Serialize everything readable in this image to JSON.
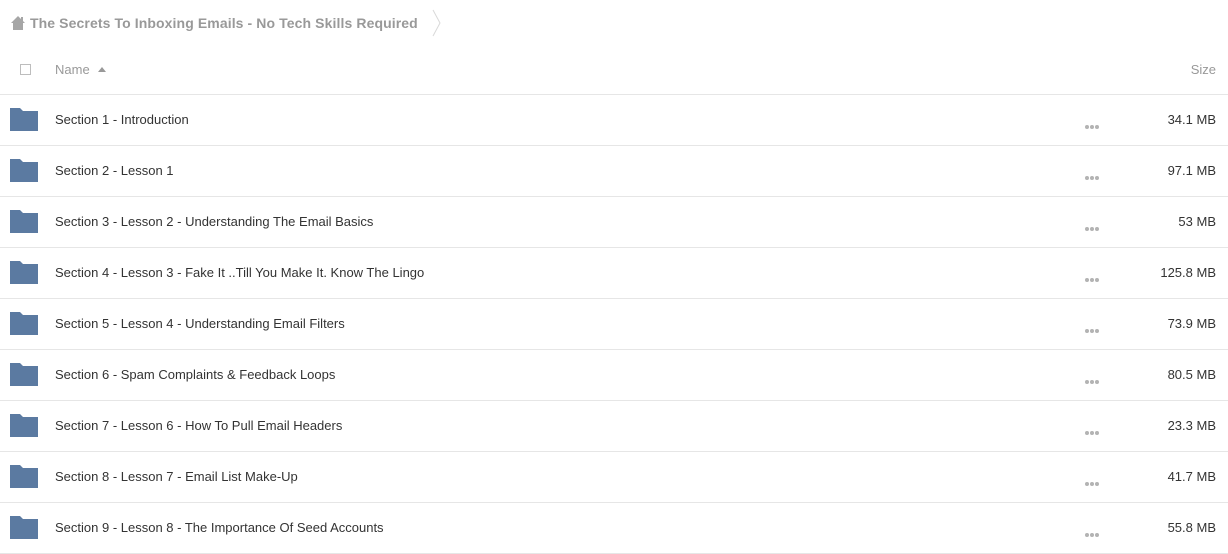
{
  "breadcrumb": {
    "home_icon": "home-icon",
    "folder_title": "The Secrets To Inboxing Emails - No Tech Skills Required"
  },
  "table_header": {
    "name_label": "Name",
    "size_label": "Size",
    "sort_direction": "ascending"
  },
  "colors": {
    "folder": "#5b7aa1",
    "muted_text": "#999999",
    "text": "#333333",
    "divider": "#e6e6e6"
  },
  "files": [
    {
      "name": "Section 1 - Introduction",
      "size": "34.1 MB",
      "type": "folder"
    },
    {
      "name": "Section 2 - Lesson 1",
      "size": "97.1 MB",
      "type": "folder"
    },
    {
      "name": "Section 3 - Lesson 2 - Understanding The Email Basics",
      "size": "53 MB",
      "type": "folder"
    },
    {
      "name": "Section 4 - Lesson 3 - Fake It ..Till You Make It. Know The Lingo",
      "size": "125.8 MB",
      "type": "folder"
    },
    {
      "name": "Section 5 - Lesson 4 - Understanding Email Filters",
      "size": "73.9 MB",
      "type": "folder"
    },
    {
      "name": "Section 6 - Spam Complaints & Feedback Loops",
      "size": "80.5 MB",
      "type": "folder"
    },
    {
      "name": "Section 7 - Lesson 6 - How To Pull Email Headers",
      "size": "23.3 MB",
      "type": "folder"
    },
    {
      "name": "Section 8 - Lesson 7 - Email List Make-Up",
      "size": "41.7 MB",
      "type": "folder"
    },
    {
      "name": "Section 9 - Lesson 8 - The Importance Of Seed Accounts",
      "size": "55.8 MB",
      "type": "folder"
    }
  ]
}
